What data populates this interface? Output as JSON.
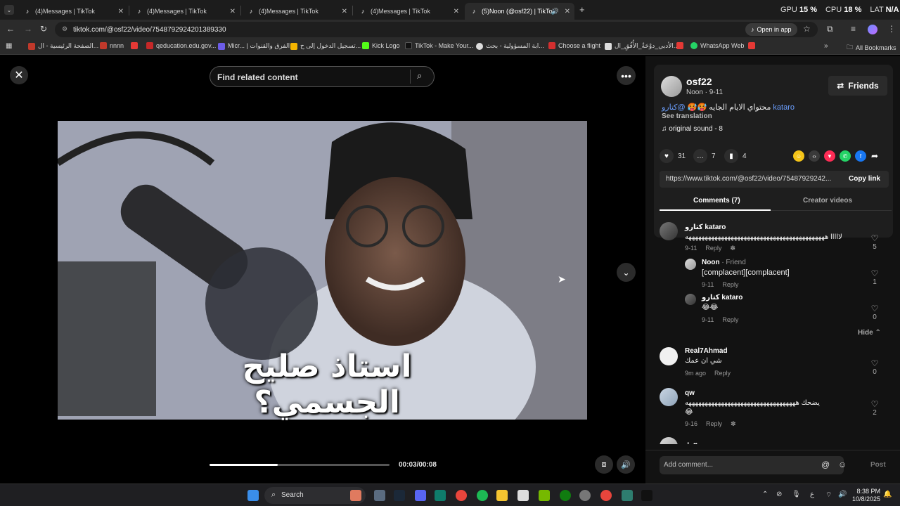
{
  "tabs": [
    {
      "title": "(4)Messages | TikTok"
    },
    {
      "title": "(4)Messages | TikTok"
    },
    {
      "title": "(4)Messages | TikTok"
    },
    {
      "title": "(4)Messages | TikTok"
    },
    {
      "title": "(5)Noon (@osf22) | TikTok",
      "active": true
    }
  ],
  "system_stats": {
    "gpu_label": "GPU",
    "gpu_value": "15 %",
    "cpu_label": "CPU",
    "cpu_value": "18 %",
    "extra_label": "LAT",
    "extra_value": "N/A"
  },
  "address_bar": {
    "url": "tiktok.com/@osf22/video/7548792924201389330",
    "open_in_app": "Open in app"
  },
  "bookmarks": [
    {
      "label": "الصفحة الرئيسية - ال...",
      "color": "#c0392b"
    },
    {
      "label": "nnnn",
      "color": "#c0392b"
    },
    {
      "label": "",
      "color": "#e53935"
    },
    {
      "label": "qeducation.edu.gov...",
      "color": "#c62828"
    },
    {
      "label": "Micr... | الفرق والقنوات",
      "color": "#6c5ce7"
    },
    {
      "label": "تسجيل الدخول إلى ح...",
      "color": "#f4b400"
    },
    {
      "label": "Kick Logo",
      "color": "#53fc18"
    },
    {
      "label": "TikTok - Make Your...",
      "color": "#111"
    },
    {
      "label": "ابة المسؤولية - بحث...",
      "color": "#ddd"
    },
    {
      "label": "Choose a flight",
      "color": "#d32f2f"
    },
    {
      "label": "الأدبي_دوْحَةُ_الأُفُقِ_ال...",
      "color": "#ddd"
    },
    {
      "label": "",
      "color": "#e53935"
    },
    {
      "label": "WhatsApp Web",
      "color": "#25d366"
    },
    {
      "label": "",
      "color": "#e53935"
    }
  ],
  "all_bookmarks": "All Bookmarks",
  "video": {
    "search_placeholder": "Find related content",
    "caption": "استاذ صليح الجسمي؟",
    "time": "00:03/00:08",
    "progress": 0.38
  },
  "post": {
    "username": "osf22",
    "subname": "Noon · 9-11",
    "friends_button": "Friends",
    "description_text": "محتواي الايام الجايه 🥵🥵",
    "description_mention": "@كتارو kataro",
    "see_translation": "See translation",
    "sound": "original sound - 8",
    "likes": "31",
    "comments": "7",
    "saves": "4",
    "link": "https://www.tiktok.com/@osf22/video/75487929242...",
    "copy_link": "Copy link",
    "tab_comments": "Comments (7)",
    "tab_creator": "Creator videos"
  },
  "comments": [
    {
      "name": "كتارو kataro",
      "text": "لااااا هههههههههههههههههههههههههههههههههههههههههههه",
      "date": "9-11",
      "reply": "Reply",
      "likes": "5"
    },
    {
      "name": "Noon",
      "friend": " · Friend",
      "text": "[complacent][complacent]",
      "date": "9-11",
      "reply": "Reply",
      "likes": "1"
    },
    {
      "name": "كتارو kataro",
      "text": "😂😂",
      "date": "9-11",
      "reply": "Reply",
      "likes": "0"
    },
    {
      "name": "Real7Ahmad",
      "text": "شي ان عمك",
      "date": "9m ago",
      "reply": "Reply",
      "likes": "0"
    },
    {
      "name": "qw",
      "text": "يضحك ههههههههههههههههههههههههههههههههههه",
      "text2": "😂",
      "date": "9-16",
      "reply": "Reply",
      "likes": "2"
    }
  ],
  "hide_label": "Hide",
  "partial_comment_name": "ㅅ ♥",
  "add_comment": {
    "placeholder": "Add comment...",
    "post": "Post"
  },
  "taskbar": {
    "search": "Search",
    "time": "8:38 PM",
    "date": "10/8/2025"
  }
}
